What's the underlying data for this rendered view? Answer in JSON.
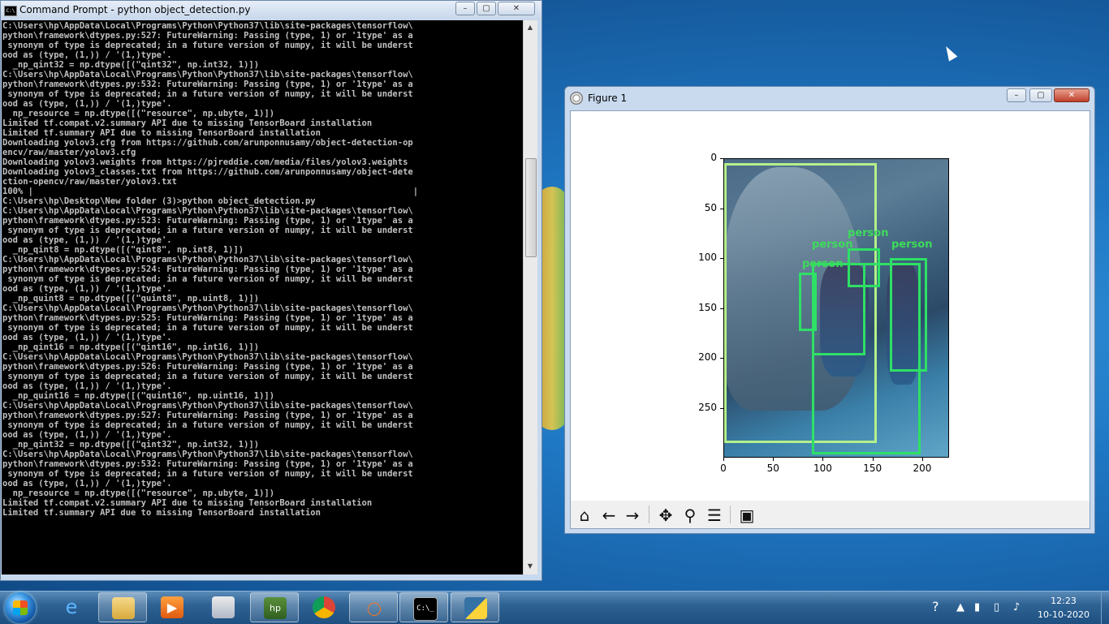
{
  "cmd_window": {
    "title": "Command Prompt - python  object_detection.py",
    "min": "–",
    "max": "▢",
    "close": "✕",
    "lines": [
      "C:\\Users\\hp\\AppData\\Local\\Programs\\Python\\Python37\\lib\\site-packages\\tensorflow\\",
      "python\\framework\\dtypes.py:527: FutureWarning: Passing (type, 1) or '1type' as a",
      " synonym of type is deprecated; in a future version of numpy, it will be underst",
      "ood as (type, (1,)) / '(1,)type'.",
      "  _np_qint32 = np.dtype([(\"qint32\", np.int32, 1)])",
      "C:\\Users\\hp\\AppData\\Local\\Programs\\Python\\Python37\\lib\\site-packages\\tensorflow\\",
      "python\\framework\\dtypes.py:532: FutureWarning: Passing (type, 1) or '1type' as a",
      " synonym of type is deprecated; in a future version of numpy, it will be underst",
      "ood as (type, (1,)) / '(1,)type'.",
      "  np_resource = np.dtype([(\"resource\", np.ubyte, 1)])",
      "Limited tf.compat.v2.summary API due to missing TensorBoard installation",
      "Limited tf.summary API due to missing TensorBoard installation",
      "Downloading yolov3.cfg from https://github.com/arunponnusamy/object-detection-op",
      "encv/raw/master/yolov3.cfg",
      "Downloading yolov3.weights from https://pjreddie.com/media/files/yolov3.weights",
      "Downloading yolov3_classes.txt from https://github.com/arunponnusamy/object-dete",
      "ction-opencv/raw/master/yolov3.txt",
      "100% |                                                                          |",
      "C:\\Users\\hp\\Desktop\\New folder (3)>python object_detection.py",
      "C:\\Users\\hp\\AppData\\Local\\Programs\\Python\\Python37\\lib\\site-packages\\tensorflow\\",
      "python\\framework\\dtypes.py:523: FutureWarning: Passing (type, 1) or '1type' as a",
      " synonym of type is deprecated; in a future version of numpy, it will be underst",
      "ood as (type, (1,)) / '(1,)type'.",
      "  _np_qint8 = np.dtype([(\"qint8\", np.int8, 1)])",
      "C:\\Users\\hp\\AppData\\Local\\Programs\\Python\\Python37\\lib\\site-packages\\tensorflow\\",
      "python\\framework\\dtypes.py:524: FutureWarning: Passing (type, 1) or '1type' as a",
      " synonym of type is deprecated; in a future version of numpy, it will be underst",
      "ood as (type, (1,)) / '(1,)type'.",
      "  _np_quint8 = np.dtype([(\"quint8\", np.uint8, 1)])",
      "C:\\Users\\hp\\AppData\\Local\\Programs\\Python\\Python37\\lib\\site-packages\\tensorflow\\",
      "python\\framework\\dtypes.py:525: FutureWarning: Passing (type, 1) or '1type' as a",
      " synonym of type is deprecated; in a future version of numpy, it will be underst",
      "ood as (type, (1,)) / '(1,)type'.",
      "  _np_qint16 = np.dtype([(\"qint16\", np.int16, 1)])",
      "C:\\Users\\hp\\AppData\\Local\\Programs\\Python\\Python37\\lib\\site-packages\\tensorflow\\",
      "python\\framework\\dtypes.py:526: FutureWarning: Passing (type, 1) or '1type' as a",
      " synonym of type is deprecated; in a future version of numpy, it will be underst",
      "ood as (type, (1,)) / '(1,)type'.",
      "  _np_quint16 = np.dtype([(\"quint16\", np.uint16, 1)])",
      "C:\\Users\\hp\\AppData\\Local\\Programs\\Python\\Python37\\lib\\site-packages\\tensorflow\\",
      "python\\framework\\dtypes.py:527: FutureWarning: Passing (type, 1) or '1type' as a",
      " synonym of type is deprecated; in a future version of numpy, it will be underst",
      "ood as (type, (1,)) / '(1,)type'.",
      "  _np_qint32 = np.dtype([(\"qint32\", np.int32, 1)])",
      "C:\\Users\\hp\\AppData\\Local\\Programs\\Python\\Python37\\lib\\site-packages\\tensorflow\\",
      "python\\framework\\dtypes.py:532: FutureWarning: Passing (type, 1) or '1type' as a",
      " synonym of type is deprecated; in a future version of numpy, it will be underst",
      "ood as (type, (1,)) / '(1,)type'.",
      "  np_resource = np.dtype([(\"resource\", np.ubyte, 1)])",
      "Limited tf.compat.v2.summary API due to missing TensorBoard installation",
      "Limited tf.summary API due to missing TensorBoard installation"
    ]
  },
  "figure_window": {
    "title": "Figure 1",
    "min": "–",
    "max": "▢",
    "close": "✕",
    "y_ticks": [
      "0",
      "50",
      "100",
      "150",
      "200",
      "250"
    ],
    "x_ticks": [
      "0",
      "50",
      "100",
      "150",
      "200"
    ],
    "detection_label": "person",
    "box_colors": {
      "elephant": "#b4f08a",
      "person": "#2ee065"
    },
    "toolbar": {
      "home": "home-icon",
      "back": "back-arrow-icon",
      "forward": "forward-arrow-icon",
      "pan": "pan-icon",
      "zoom": "zoom-icon",
      "configure": "configure-subplots-icon",
      "save": "save-icon"
    }
  },
  "taskbar": {
    "clock_time": "12:23",
    "clock_date": "10-10-2020",
    "apps": [
      "internet-explorer-icon",
      "file-explorer-icon",
      "media-player-icon",
      "paint-icon",
      "hp-icon",
      "chrome-icon",
      "jupyter-icon",
      "command-prompt-icon",
      "python-icon"
    ]
  }
}
